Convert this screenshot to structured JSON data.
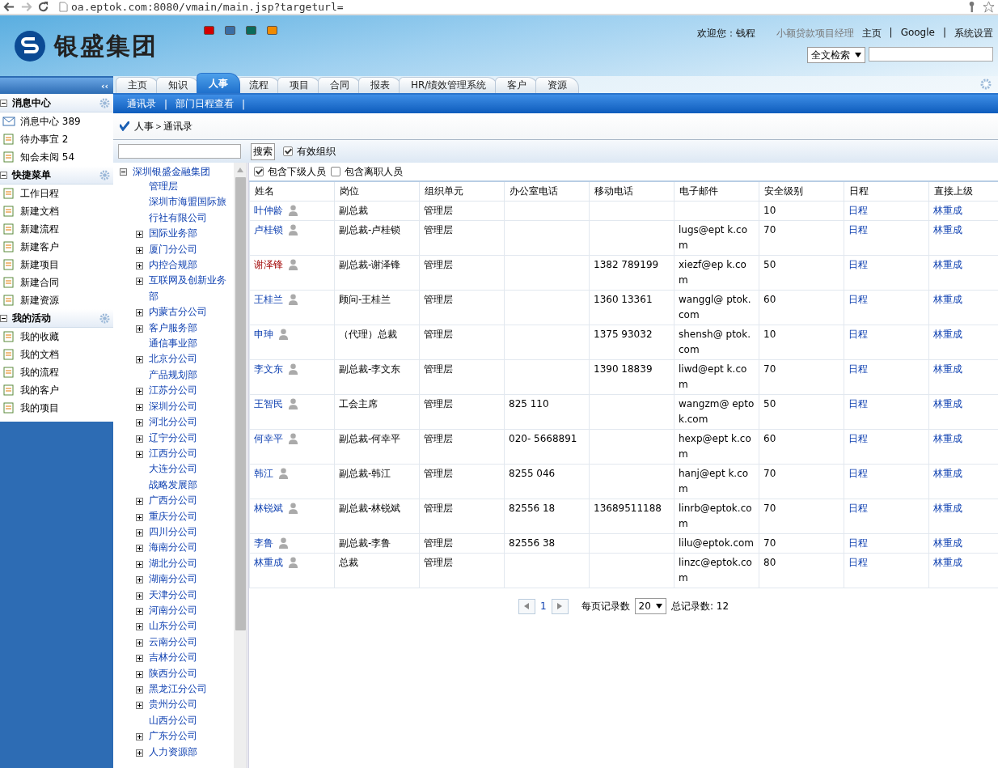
{
  "browser": {
    "url": "oa.eptok.com:8080/vmain/main.jsp?targeturl="
  },
  "header": {
    "logo_text": "银盛集团",
    "themes": [
      {
        "color": "#d40000"
      },
      {
        "color": "#3a6ea5"
      },
      {
        "color": "#0a6b5a"
      },
      {
        "color": "#f08a00"
      }
    ],
    "welcome": "欢迎您：钱程",
    "role": "小额贷款项目经理",
    "links": [
      "主页",
      "|",
      "Google",
      "|",
      "系统设置"
    ],
    "search_scope": "全文检索"
  },
  "tabs": [
    {
      "label": "主页",
      "selected": false
    },
    {
      "label": "知识",
      "selected": false
    },
    {
      "label": "人事",
      "selected": true
    },
    {
      "label": "流程",
      "selected": false
    },
    {
      "label": "项目",
      "selected": false
    },
    {
      "label": "合同",
      "selected": false
    },
    {
      "label": "报表",
      "selected": false
    },
    {
      "label": "HR/绩效管理系统",
      "selected": false
    },
    {
      "label": "客户",
      "selected": false
    },
    {
      "label": "资源",
      "selected": false
    }
  ],
  "subnav": [
    {
      "label": "通讯录",
      "sep": "|"
    },
    {
      "label": "部门日程查看",
      "sep": "|"
    }
  ],
  "sidebar": {
    "collapse": "‹‹",
    "sections": [
      {
        "title": "消息中心",
        "items": [
          "消息中心 389",
          "待办事宜 2",
          "知会未阅 54"
        ]
      },
      {
        "title": "快捷菜单",
        "items": [
          "工作日程",
          "新建文档",
          "新建流程",
          "新建客户",
          "新建项目",
          "新建合同",
          "新建资源"
        ]
      },
      {
        "title": "我的活动",
        "items": [
          "我的收藏",
          "我的文档",
          "我的流程",
          "我的客户",
          "我的项目"
        ]
      }
    ]
  },
  "breadcrumb": "人事＞通讯录",
  "search": {
    "button": "搜索",
    "filters": [
      {
        "label": "有效组织",
        "checked": true
      },
      {
        "label": "包含下级人员",
        "checked": true
      },
      {
        "label": "包含离职人员",
        "checked": false
      }
    ]
  },
  "tree": {
    "label": "深圳银盛金融集团",
    "expanded": true,
    "children": [
      {
        "label": "管理层",
        "expandable": false
      },
      {
        "label": "深圳市海盟国际旅行社有限公司",
        "expandable": false
      },
      {
        "label": "国际业务部",
        "expandable": true
      },
      {
        "label": "厦门分公司",
        "expandable": true
      },
      {
        "label": "内控合规部",
        "expandable": true
      },
      {
        "label": "互联网及创新业务部",
        "expandable": true
      },
      {
        "label": "内蒙古分公司",
        "expandable": true
      },
      {
        "label": "客户服务部",
        "expandable": true
      },
      {
        "label": "通信事业部",
        "expandable": false
      },
      {
        "label": "北京分公司",
        "expandable": true
      },
      {
        "label": "产品规划部",
        "expandable": false
      },
      {
        "label": "江苏分公司",
        "expandable": true
      },
      {
        "label": "深圳分公司",
        "expandable": true
      },
      {
        "label": "河北分公司",
        "expandable": true
      },
      {
        "label": "辽宁分公司",
        "expandable": true
      },
      {
        "label": "江西分公司",
        "expandable": true
      },
      {
        "label": "大连分公司",
        "expandable": false
      },
      {
        "label": "战略发展部",
        "expandable": false
      },
      {
        "label": "广西分公司",
        "expandable": true
      },
      {
        "label": "重庆分公司",
        "expandable": true
      },
      {
        "label": "四川分公司",
        "expandable": true
      },
      {
        "label": "海南分公司",
        "expandable": true
      },
      {
        "label": "湖北分公司",
        "expandable": true
      },
      {
        "label": "湖南分公司",
        "expandable": true
      },
      {
        "label": "天津分公司",
        "expandable": true
      },
      {
        "label": "河南分公司",
        "expandable": true
      },
      {
        "label": "山东分公司",
        "expandable": true
      },
      {
        "label": "云南分公司",
        "expandable": true
      },
      {
        "label": "吉林分公司",
        "expandable": true
      },
      {
        "label": "陕西分公司",
        "expandable": true
      },
      {
        "label": "黑龙江分公司",
        "expandable": true
      },
      {
        "label": "贵州分公司",
        "expandable": true
      },
      {
        "label": "山西分公司",
        "expandable": false
      },
      {
        "label": "广东分公司",
        "expandable": true
      },
      {
        "label": "人力资源部",
        "expandable": true
      }
    ]
  },
  "table": {
    "columns": [
      "姓名",
      "岗位",
      "组织单元",
      "办公室电话",
      "移动电话",
      "电子邮件",
      "安全级别",
      "日程",
      "直接上级"
    ],
    "rows": [
      {
        "name": "叶仲龄",
        "highlighted": false,
        "position": "副总裁",
        "unit": "管理层",
        "office": "",
        "mobile": "",
        "email": "",
        "level": "10",
        "schedule": "日程",
        "manager": "林重成"
      },
      {
        "name": "卢桂锁",
        "highlighted": false,
        "position": "副总裁-卢桂锁",
        "unit": "管理层",
        "office": "",
        "mobile": "",
        "email": "lugs@ept k.com",
        "level": "70",
        "schedule": "日程",
        "manager": "林重成"
      },
      {
        "name": "谢泽锋",
        "highlighted": true,
        "position": "副总裁-谢泽锋",
        "unit": "管理层",
        "office": "",
        "mobile": "1382 789199",
        "email": "xiezf@ep k.com",
        "level": "50",
        "schedule": "日程",
        "manager": "林重成"
      },
      {
        "name": "王桂兰",
        "highlighted": false,
        "position": "顾问-王桂兰",
        "unit": "管理层",
        "office": "",
        "mobile": "1360 13361",
        "email": "wanggl@ ptok.com",
        "level": "60",
        "schedule": "日程",
        "manager": "林重成"
      },
      {
        "name": "申珅",
        "highlighted": false,
        "position": "（代理）总裁",
        "unit": "管理层",
        "office": "",
        "mobile": "1375 93032",
        "email": "shensh@ ptok.com",
        "level": "10",
        "schedule": "日程",
        "manager": "林重成"
      },
      {
        "name": "李文东",
        "highlighted": false,
        "position": "副总裁-李文东",
        "unit": "管理层",
        "office": "",
        "mobile": "1390 18839",
        "email": "liwd@ept k.com",
        "level": "70",
        "schedule": "日程",
        "manager": "林重成"
      },
      {
        "name": "王智民",
        "highlighted": false,
        "position": "工会主席",
        "unit": "管理层",
        "office": "825 110",
        "mobile": "",
        "email": "wangzm@ eptok.com",
        "level": "50",
        "schedule": "日程",
        "manager": "林重成"
      },
      {
        "name": "何幸平",
        "highlighted": false,
        "position": "副总裁-何幸平",
        "unit": "管理层",
        "office": "020- 5668891",
        "mobile": "",
        "email": "hexp@ept k.com",
        "level": "60",
        "schedule": "日程",
        "manager": "林重成"
      },
      {
        "name": "韩江",
        "highlighted": false,
        "position": "副总裁-韩江",
        "unit": "管理层",
        "office": "8255 046",
        "mobile": "",
        "email": "hanj@ept k.com",
        "level": "70",
        "schedule": "日程",
        "manager": "林重成"
      },
      {
        "name": "林锐斌",
        "highlighted": false,
        "position": "副总裁-林锐斌",
        "unit": "管理层",
        "office": "82556 18",
        "mobile": "13689511188",
        "email": "linrb@eptok.com",
        "level": "70",
        "schedule": "日程",
        "manager": "林重成"
      },
      {
        "name": "李鲁",
        "highlighted": false,
        "position": "副总裁-李鲁",
        "unit": "管理层",
        "office": "82556 38",
        "mobile": "",
        "email": "lilu@eptok.com",
        "level": "70",
        "schedule": "日程",
        "manager": "林重成"
      },
      {
        "name": "林重成",
        "highlighted": false,
        "position": "总裁",
        "unit": "管理层",
        "office": "",
        "mobile": "",
        "email": "linzc@eptok.com",
        "level": "80",
        "schedule": "日程",
        "manager": "林重成"
      }
    ]
  },
  "pagination": {
    "page": "1",
    "per_page_label": "每页记录数",
    "per_page": "20",
    "total": "总记录数: 12"
  }
}
